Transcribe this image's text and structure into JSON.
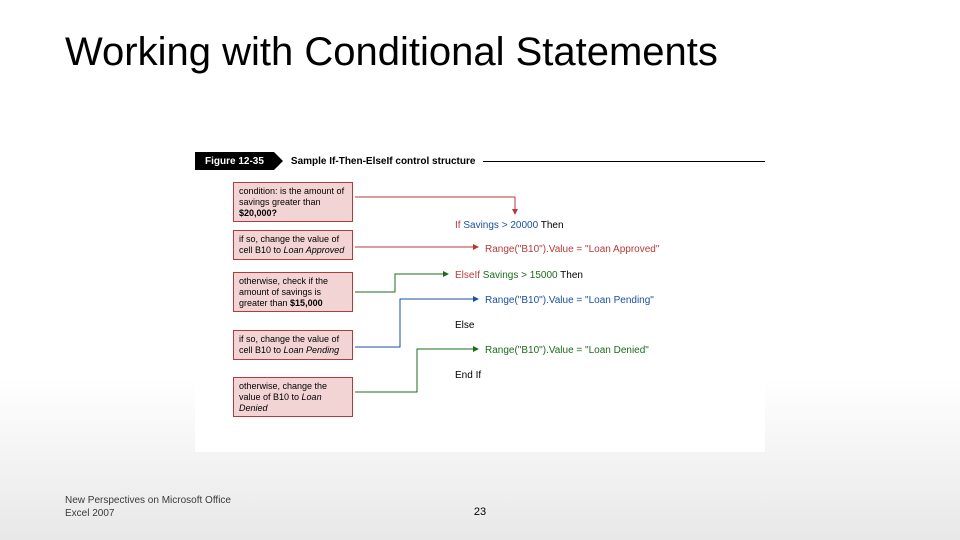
{
  "title": "Working with Conditional Statements",
  "figure": {
    "label": "Figure 12-35",
    "caption": "Sample If-Then-ElseIf control structure"
  },
  "callouts": {
    "c1a": "condition: is the amount of savings greater than ",
    "c1b": "$20,000?",
    "c2a": "if so, change the value of cell B10 to ",
    "c2b": "Loan Approved",
    "c3a": "otherwise, check if the amount of savings is greater than ",
    "c3b": "$15,000",
    "c4a": "if so, change the value of cell B10 to ",
    "c4b": "Loan Pending",
    "c5a": "otherwise, change the value of B10 to ",
    "c5b": "Loan Denied"
  },
  "code": {
    "l1_if": "If ",
    "l1_cond": "Savings > 20000",
    "l1_then": " Then",
    "l2": "Range(\"B10\").Value = \"Loan Approved\"",
    "l3_elif": "ElseIf ",
    "l3_cond": "Savings > 15000",
    "l3_then": " Then",
    "l4": "Range(\"B10\").Value = \"Loan Pending\"",
    "l5": "Else",
    "l6": "Range(\"B10\").Value = \"Loan Denied\"",
    "l7": "End If"
  },
  "footer": {
    "source1": "New Perspectives on Microsoft Office",
    "source2": "Excel 2007",
    "page": "23"
  },
  "colors": {
    "callout_fill": "#f3d4d4",
    "callout_border": "#b53a3a",
    "red": "#b53a3a",
    "blue": "#1a4fa3",
    "green": "#1a6e1a"
  }
}
